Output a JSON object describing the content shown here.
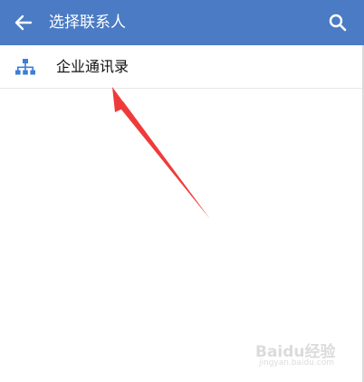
{
  "header": {
    "title": "选择联系人",
    "back_icon": "arrow-left-icon",
    "search_icon": "search-icon"
  },
  "list": {
    "items": [
      {
        "label": "企业通讯录",
        "icon": "org-chart-icon"
      }
    ]
  },
  "watermark": {
    "text": "Baidu经验",
    "sub": "jingyan.baidu.com"
  },
  "colors": {
    "app_bar": "#4a7bc4",
    "icon_blue": "#3b7fd6",
    "annotation_arrow": "#f03a3a"
  }
}
